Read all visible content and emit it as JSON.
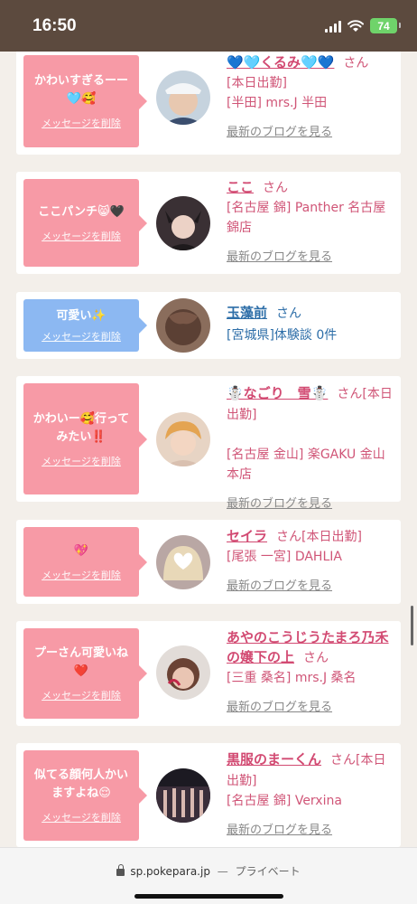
{
  "status_bar": {
    "time": "16:50",
    "battery": "74",
    "icons": [
      "signal-icon",
      "wifi-icon",
      "battery-icon"
    ]
  },
  "cards": [
    {
      "message": "かわいすぎるーー🩵🥰",
      "delete_label": "メッセージを削除",
      "name": "💙🩵くるみ🩵💙",
      "honorific": "さん",
      "status": "[本日出勤]",
      "shop": "[半田] mrs.J 半田",
      "blog_label": "最新のブログを見る",
      "bubble_color": "#f79aa6"
    },
    {
      "message": "ここパンチ😸🖤",
      "delete_label": "メッセージを削除",
      "name": "ここ",
      "honorific": "さん",
      "status": "",
      "shop": "[名古屋 錦] Panther 名古屋錦店",
      "blog_label": "最新のブログを見る",
      "bubble_color": "#f79aa6"
    },
    {
      "message": "可愛い✨",
      "delete_label": "メッセージを削除",
      "name": "玉藻前",
      "honorific": "さん",
      "status": "",
      "shop": "[宮城県]体験談 0件",
      "blog_label": "",
      "bubble_color": "#8cb8f2"
    },
    {
      "message": "かわいー🥰行ってみたい‼️",
      "delete_label": "メッセージを削除",
      "name": "☃️なごり　雪☃️",
      "honorific": "さん[本日出勤]",
      "status": "",
      "shop": "[名古屋 金山] 楽GAKU 金山本店",
      "blog_label": "最新のブログを見る",
      "bubble_color": "#f79aa6"
    },
    {
      "message": "💖",
      "delete_label": "メッセージを削除",
      "name": "セイラ",
      "honorific": "さん[本日出勤]",
      "status": "",
      "shop": "[尾張 一宮] DAHLIA",
      "blog_label": "最新のブログを見る",
      "bubble_color": "#f79aa6"
    },
    {
      "message": "プーさん可愛いね❤️",
      "delete_label": "メッセージを削除",
      "name": "あやのこうじうたまろ乃禾の嬢下の上",
      "honorific": "さん",
      "status": "",
      "shop": "[三重 桑名] mrs.J 桑名",
      "blog_label": "最新のブログを見る",
      "bubble_color": "#f79aa6"
    },
    {
      "message": "似てる顔何人かいますよね😌",
      "delete_label": "メッセージを削除",
      "name": "黒服のまーくん",
      "honorific": "さん[本日出勤]",
      "status": "",
      "shop": "[名古屋 錦] Verxina",
      "blog_label": "最新のブログを見る",
      "bubble_color": "#f79aa6"
    }
  ],
  "url_bar": {
    "domain": "sp.pokepara.jp",
    "separator": "—",
    "mode": "プライベート"
  }
}
